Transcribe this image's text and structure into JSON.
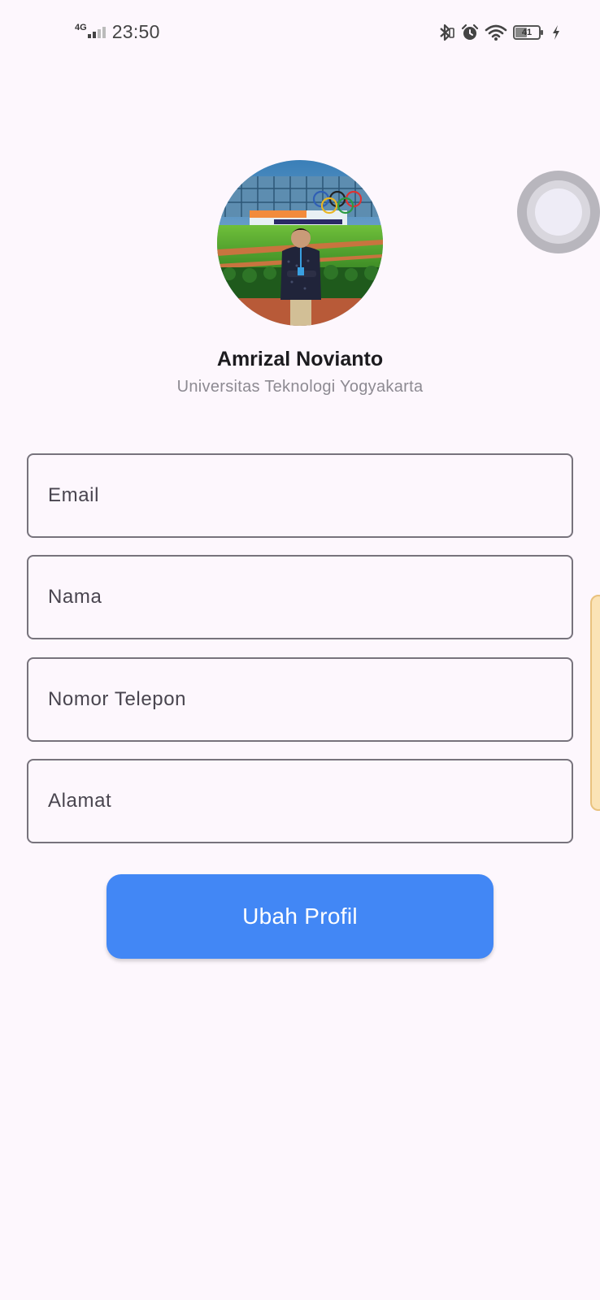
{
  "status_bar": {
    "network_type": "4G",
    "time": "23:50",
    "battery_level": "41",
    "icons": [
      "bluetooth-icon",
      "alarm-icon",
      "wifi-icon",
      "battery-icon",
      "charging-icon"
    ]
  },
  "profile": {
    "name": "Amrizal Novianto",
    "subtitle": "Universitas Teknologi Yogyakarta",
    "avatar": "profile-photo"
  },
  "form": {
    "email_placeholder": "Email",
    "name_placeholder": "Nama",
    "phone_placeholder": "Nomor Telepon",
    "address_placeholder": "Alamat"
  },
  "actions": {
    "submit_label": "Ubah Profil"
  },
  "colors": {
    "background": "#fdf7fd",
    "primary": "#4287f5",
    "field_border": "#77737c",
    "subtitle": "#8d8a92"
  }
}
